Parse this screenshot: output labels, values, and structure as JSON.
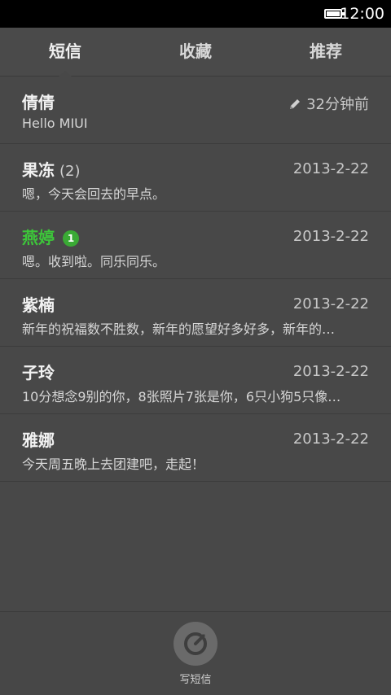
{
  "status_bar": {
    "time": "12:00"
  },
  "tabs": [
    {
      "label": "短信",
      "active": true
    },
    {
      "label": "收藏",
      "active": false
    },
    {
      "label": "推荐",
      "active": false
    }
  ],
  "conversations": [
    {
      "name": "倩倩",
      "count": "",
      "badge": "",
      "time": "32分钟前",
      "draft_icon": "pencil-icon",
      "preview": "Hello MIUI"
    },
    {
      "name": "果冻",
      "count": "(2)",
      "badge": "",
      "time": "2013-2-22",
      "preview": "嗯，今天会回去的早点。"
    },
    {
      "name": "燕婷",
      "count": "",
      "badge": "1",
      "time": "2013-2-22",
      "preview": "嗯。收到啦。同乐同乐。",
      "accent_color": "#3dc63a"
    },
    {
      "name": "紫楠",
      "count": "",
      "badge": "",
      "time": "2013-2-22",
      "preview": "新年的祝福数不胜数，新年的愿望好多好多，新年的…"
    },
    {
      "name": "子玲",
      "count": "",
      "badge": "",
      "time": "2013-2-22",
      "preview": "10分想念9别的你，8张照片7张是你，6只小狗5只像…"
    },
    {
      "name": "雅娜",
      "count": "",
      "badge": "",
      "time": "2013-2-22",
      "preview": "今天周五晚上去团建吧，走起！"
    }
  ],
  "compose": {
    "label": "写短信",
    "icon": "compose-icon"
  }
}
